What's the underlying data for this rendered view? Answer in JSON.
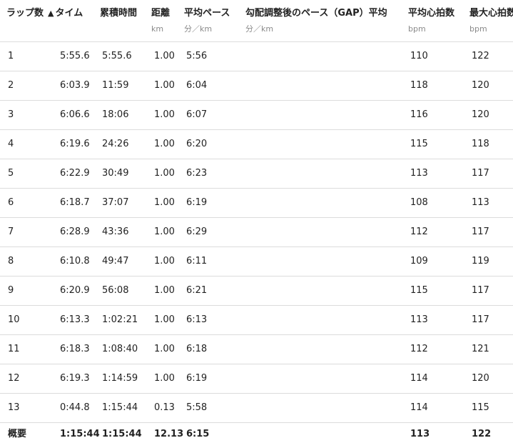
{
  "columns": {
    "lap": {
      "label": "ラップ数"
    },
    "time": {
      "sort_indicator": "▲",
      "label": "タイム"
    },
    "cumulative": {
      "label": "累積時間"
    },
    "distance": {
      "label": "距離",
      "unit": "km"
    },
    "pace": {
      "label": "平均ペース",
      "unit": "分／km"
    },
    "gap": {
      "label": "勾配調整後のペース（GAP）平均",
      "unit": "分／km"
    },
    "avg_hr": {
      "label": "平均心拍数",
      "unit": "bpm"
    },
    "max_hr": {
      "label": "最大心拍数",
      "unit": "bpm"
    }
  },
  "rows": [
    {
      "lap": "1",
      "time": "5:55.6",
      "cumulative": "5:55.6",
      "distance": "1.00",
      "pace": "5:56",
      "gap": "",
      "avg_hr": "110",
      "max_hr": "122"
    },
    {
      "lap": "2",
      "time": "6:03.9",
      "cumulative": "11:59",
      "distance": "1.00",
      "pace": "6:04",
      "gap": "",
      "avg_hr": "118",
      "max_hr": "120"
    },
    {
      "lap": "3",
      "time": "6:06.6",
      "cumulative": "18:06",
      "distance": "1.00",
      "pace": "6:07",
      "gap": "",
      "avg_hr": "116",
      "max_hr": "120"
    },
    {
      "lap": "4",
      "time": "6:19.6",
      "cumulative": "24:26",
      "distance": "1.00",
      "pace": "6:20",
      "gap": "",
      "avg_hr": "115",
      "max_hr": "118"
    },
    {
      "lap": "5",
      "time": "6:22.9",
      "cumulative": "30:49",
      "distance": "1.00",
      "pace": "6:23",
      "gap": "",
      "avg_hr": "113",
      "max_hr": "117"
    },
    {
      "lap": "6",
      "time": "6:18.7",
      "cumulative": "37:07",
      "distance": "1.00",
      "pace": "6:19",
      "gap": "",
      "avg_hr": "108",
      "max_hr": "113"
    },
    {
      "lap": "7",
      "time": "6:28.9",
      "cumulative": "43:36",
      "distance": "1.00",
      "pace": "6:29",
      "gap": "",
      "avg_hr": "112",
      "max_hr": "117"
    },
    {
      "lap": "8",
      "time": "6:10.8",
      "cumulative": "49:47",
      "distance": "1.00",
      "pace": "6:11",
      "gap": "",
      "avg_hr": "109",
      "max_hr": "119"
    },
    {
      "lap": "9",
      "time": "6:20.9",
      "cumulative": "56:08",
      "distance": "1.00",
      "pace": "6:21",
      "gap": "",
      "avg_hr": "115",
      "max_hr": "117"
    },
    {
      "lap": "10",
      "time": "6:13.3",
      "cumulative": "1:02:21",
      "distance": "1.00",
      "pace": "6:13",
      "gap": "",
      "avg_hr": "113",
      "max_hr": "117"
    },
    {
      "lap": "11",
      "time": "6:18.3",
      "cumulative": "1:08:40",
      "distance": "1.00",
      "pace": "6:18",
      "gap": "",
      "avg_hr": "112",
      "max_hr": "121"
    },
    {
      "lap": "12",
      "time": "6:19.3",
      "cumulative": "1:14:59",
      "distance": "1.00",
      "pace": "6:19",
      "gap": "",
      "avg_hr": "114",
      "max_hr": "120"
    },
    {
      "lap": "13",
      "time": "0:44.8",
      "cumulative": "1:15:44",
      "distance": "0.13",
      "pace": "5:58",
      "gap": "",
      "avg_hr": "114",
      "max_hr": "115"
    }
  ],
  "summary": {
    "lap": "概要",
    "time": "1:15:44",
    "cumulative": "1:15:44",
    "distance": "12.13",
    "pace": "6:15",
    "gap": "",
    "avg_hr": "113",
    "max_hr": "122"
  }
}
